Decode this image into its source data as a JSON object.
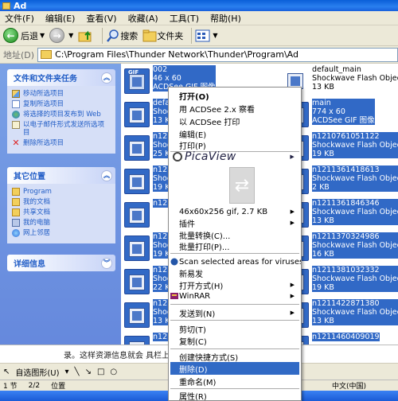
{
  "window": {
    "title": "Ad"
  },
  "menu": [
    "文件(F)",
    "编辑(E)",
    "查看(V)",
    "收藏(A)",
    "工具(T)",
    "帮助(H)"
  ],
  "toolbar": {
    "back_label": "后退",
    "search_label": "搜索",
    "folders_label": "文件夹"
  },
  "address": {
    "label": "地址(D)",
    "path": "C:\\Program Files\\Thunder Network\\Thunder\\Program\\Ad"
  },
  "tasks": {
    "title": "文件和文件夹任务",
    "items": [
      "移动所选项目",
      "复制所选项目",
      "将选择的项目发布到 Web",
      "以电子邮件形式发送所选项目",
      "删除所选项目"
    ]
  },
  "other_places": {
    "title": "其它位置",
    "items": [
      "Program",
      "我的文档",
      "共享文档",
      "我的电脑",
      "网上邻居"
    ]
  },
  "details": {
    "title": "详细信息"
  },
  "files_left": [
    {
      "name": "002",
      "line2": "46 x 60",
      "line3": "ACDSee GIF 图像",
      "selected": true
    },
    {
      "name": "defa",
      "line2": "Shoc",
      "line3": "13 K",
      "selected": true
    },
    {
      "name": "n121",
      "line2": "Shoc",
      "line3": "25 K",
      "selected": true
    },
    {
      "name": "n121",
      "line2": "Shoc",
      "line3": "19 K",
      "selected": true
    },
    {
      "name": "n121",
      "line2": "",
      "line3": "",
      "selected": true
    },
    {
      "name": "n121",
      "line2": "Shoc",
      "line3": "19 K",
      "selected": true
    },
    {
      "name": "n121",
      "line2": "Shoc",
      "line3": "22 K",
      "selected": true
    },
    {
      "name": "n121",
      "line2": "Shoc",
      "line3": "13 K",
      "selected": true
    },
    {
      "name": "n121",
      "line2": "",
      "line3": "",
      "selected": true
    }
  ],
  "files_right": [
    {
      "name": "default_main",
      "line2": "Shockwave Flash Object",
      "line3": "13 KB",
      "selected": false
    },
    {
      "name": "main",
      "line2": "774 x 60",
      "line3": "ACDSee GIF 图像",
      "selected": true
    },
    {
      "name": "n1210761051122",
      "line2": "Shockwave Flash Object",
      "line3": "19 KB",
      "selected": true
    },
    {
      "name": "n1211361418613",
      "line2": "Shockwave Flash Object",
      "line3": "2 KB",
      "selected": true
    },
    {
      "name": "n1211361846346",
      "line2": "Shockwave Flash Object",
      "line3": "13 KB",
      "selected": true
    },
    {
      "name": "n1211370324986",
      "line2": "Shockwave Flash Object",
      "line3": "16 KB",
      "selected": true
    },
    {
      "name": "n1211381032332",
      "line2": "Shockwave Flash Object",
      "line3": "19 KB",
      "selected": true
    },
    {
      "name": "n1211422871380",
      "line2": "Shockwave Flash Object",
      "line3": "13 KB",
      "selected": true
    },
    {
      "name": "n1211460409019",
      "line2": "",
      "line3": "",
      "selected": true
    }
  ],
  "context_menu": {
    "open": "打开(O)",
    "acdsee_view": "用 ACDSee 2.x 察看",
    "acdsee_print": "以 ACDSee 打印",
    "edit": "编辑(E)",
    "print": "打印(P)",
    "picaview": "PicaView",
    "image_info": "46x60x256 gif, 2.7 KB",
    "plugins": "插件",
    "batch_convert": "批量转换(C)...",
    "batch_print": "批量打印(P)...",
    "scan": "Scan selected areas for viruses",
    "new_post": "新易发",
    "open_with": "打开方式(H)",
    "winrar": "WinRAR",
    "send_to": "发送到(N)",
    "cut": "剪切(T)",
    "copy": "复制(C)",
    "create_shortcut": "创建快捷方式(S)",
    "delete": "删除(D)",
    "rename": "重命名(M)",
    "properties": "属性(R)"
  },
  "doc_text": "录。这样资源信息就会    具栏上的搜索工具。也",
  "drawbar": {
    "autoshapes": "自选图形(U)"
  },
  "statusbar": {
    "section": "1 节",
    "page": "2/2",
    "position": "位置",
    "lang": "中文(中国)"
  },
  "colors": {
    "selection": "#316ac5",
    "taskpane": "#7aa1e6",
    "titlebar": "#0a5fd8"
  }
}
